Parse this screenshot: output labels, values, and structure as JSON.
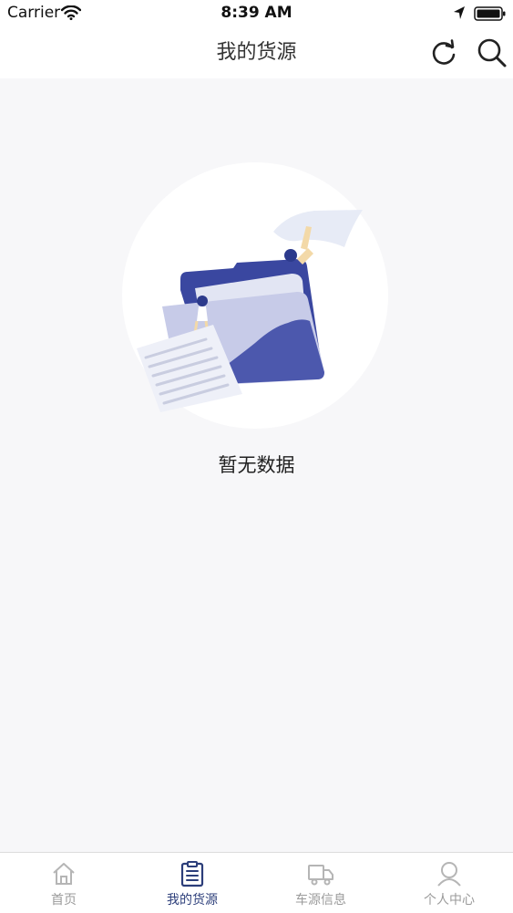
{
  "status_bar": {
    "carrier": "Carrier",
    "time": "8:39 AM"
  },
  "header": {
    "title": "我的货源"
  },
  "empty_state": {
    "message": "暂无数据"
  },
  "tab_bar": {
    "items": [
      {
        "label": "首页",
        "icon": "home-icon",
        "active": false
      },
      {
        "label": "我的货源",
        "icon": "clipboard-list-icon",
        "active": true
      },
      {
        "label": "车源信息",
        "icon": "truck-icon",
        "active": false
      },
      {
        "label": "个人中心",
        "icon": "person-icon",
        "active": false
      }
    ]
  },
  "colors": {
    "accent": "#2c3e7a",
    "tab_inactive": "#9b9b9b",
    "background": "#f7f7f9",
    "illustration_primary": "#3d4aa0",
    "illustration_light": "#c5c9e8"
  }
}
